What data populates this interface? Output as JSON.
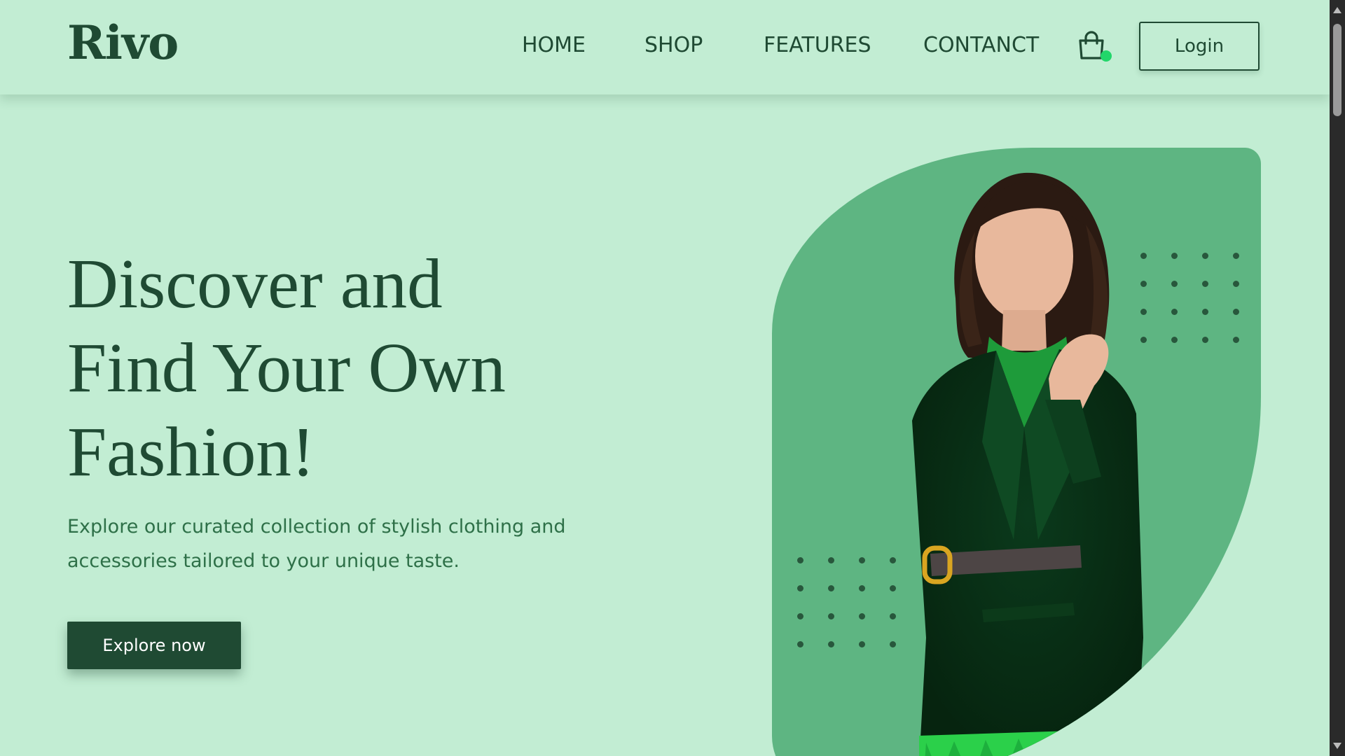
{
  "header": {
    "logo": "Rivo",
    "nav": [
      {
        "label": "HOME"
      },
      {
        "label": "SHOP"
      },
      {
        "label": "FEATURES"
      },
      {
        "label": "CONTANCT"
      }
    ],
    "cart_icon": "shopping-bag-icon",
    "login_label": "Login"
  },
  "hero": {
    "title_lines": [
      "Discover and",
      "Find Your Own",
      "Fashion!"
    ],
    "subtitle": "Explore our curated collection of stylish clothing and accessories tailored to your unique taste.",
    "cta_label": "Explore now",
    "image": "woman-in-green-blazer-photo"
  },
  "colors": {
    "background": "#c2edd3",
    "primary": "#1f4a33",
    "accent_blob": "#5eb582",
    "cart_badge": "#22d66a",
    "subtitle_text": "#2e7048"
  }
}
